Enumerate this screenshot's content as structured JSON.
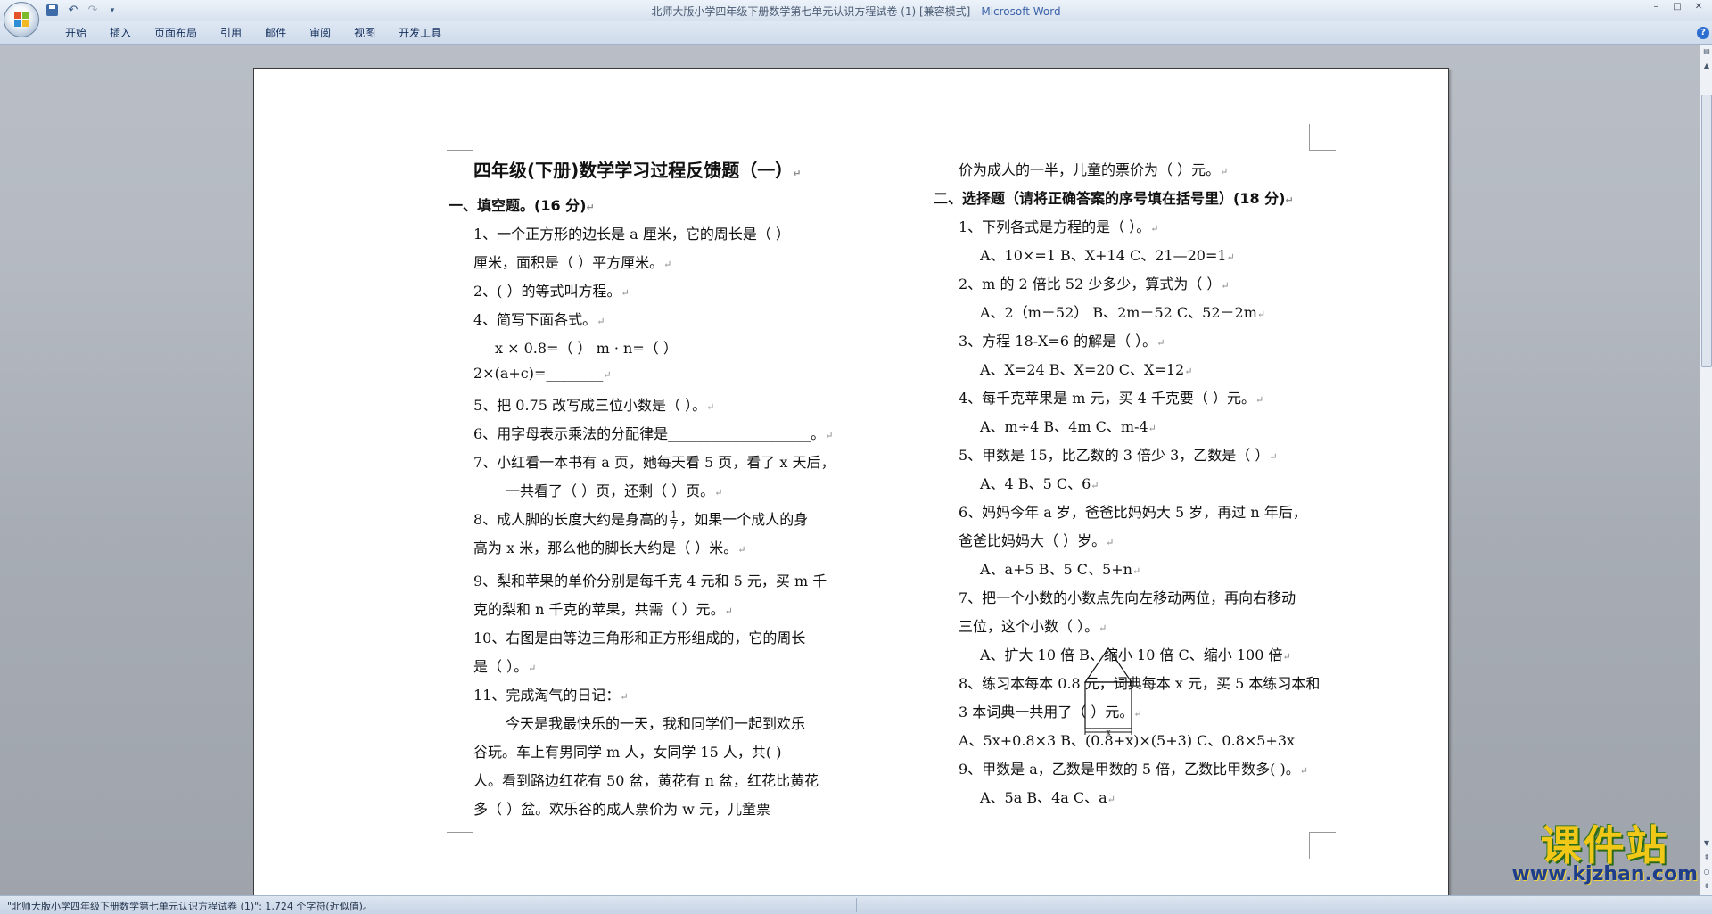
{
  "window": {
    "title": "北师大版小学四年级下册数学第七单元认识方程试卷 (1) [兼容模式]",
    "title_sep": " - ",
    "app": "Microsoft Word",
    "controls": [
      "–",
      "□",
      "✕"
    ]
  },
  "qat": {
    "items": [
      "save",
      "undo",
      "redo",
      "customize"
    ],
    "undo_glyph": "↶",
    "redo_glyph": "↷",
    "more_glyph": "▾"
  },
  "ribbon": {
    "tabs": [
      "开始",
      "插入",
      "页面布局",
      "引用",
      "邮件",
      "审阅",
      "视图",
      "开发工具"
    ],
    "help": "?"
  },
  "document": {
    "title": "四年级(下册)数学学习过程反馈题（一）",
    "left": [
      "一、填空题。(16 分)",
      "1、一个正方形的边长是 a 厘米，它的周长是（        ）",
      "厘米，面积是（        ）平方厘米。",
      "2、(                                        ）的等式叫方程。",
      "4、简写下面各式。",
      "x × 0.8=（          ）           m · n=（            ）",
      "2×(a+c)=________",
      "5、把 0.75 改写成三位小数是（          ）。",
      "6、用字母表示乘法的分配律是____________________。",
      "7、小红看一本书有 a 页，她每天看 5 页，看了 x 天后，",
      "一共看了（        ）页，还剩（          ）页。",
      "8、成人脚的长度大约是身高的",
      "，如果一个成人的身",
      "高为 x 米，那么他的脚长大约是（            ）米。",
      "9、梨和苹果的单价分别是每千克 4 元和 5 元，买 m 千",
      "克的梨和 n 千克的苹果，共需（          ）元。",
      "10、右图是由等边三角形和正方形组成的，它的周长",
      "是（          ）。",
      "11、完成淘气的日记：",
      "今天是我最快乐的一天，我和同学们一起到欢乐",
      "谷玩。车上有男同学 m 人，女同学 15 人，共(          )",
      "人。看到路边红花有 50 盆，黄花有 n 盆，红花比黄花",
      "多（            ）盆。欢乐谷的成人票价为 w 元，儿童票"
    ],
    "fraction": {
      "num": "1",
      "den": "7"
    },
    "figure_label": "x",
    "right": [
      "价为成人的一半，儿童的票价为（          ）元。",
      "二、选择题（请将正确答案的序号填在括号里）(18 分)",
      "1、下列各式是方程的是（          ）。",
      "A、10×=1          B、X+14          C、21—20=1",
      "2、m 的 2 倍比 52 少多少，算式为（          ）",
      "A、2（m－52）       B、2m－52       C、52－2m",
      "3、方程 18-X=6 的解是（          ）。",
      "A、X=24          B、X=20          C、X=12",
      "4、每千克苹果是 m 元，买 4 千克要（          ）元。",
      "A、m÷4          B、4m               C、m-4",
      "5、甲数是 15，比乙数的 3 倍少 3，乙数是（          ）",
      "A、4                    B、5                    C、6",
      "6、妈妈今年 a 岁，爸爸比妈妈大 5 岁，再过 n 年后，",
      "爸爸比妈妈大（        ）岁。",
      "A、a+5                B、5                    C、5+n",
      "7、把一个小数的小数点先向左移动两位，再向右移动",
      "三位，这个小数（        ）。",
      "A、扩大 10 倍     B、缩小 10 倍     C、缩小 100 倍",
      "8、练习本每本 0.8 元，词典每本 x 元，买 5 本练习本和",
      "3 本词典一共用了（        ）元。",
      "A、5x+0.8×3  B、(0.8+x)×(5+3)  C、0.8×5+3x",
      "9、甲数是 a，乙数是甲数的 5 倍，乙数比甲数多(          )。",
      "A、5a                  B、4a                  C、a"
    ],
    "para_mark": "↵"
  },
  "status": {
    "text": "\"北师大版小学四年级下册数学第七单元认识方程试卷 (1)\": 1,724 个字符(近似值)。"
  },
  "watermark": {
    "text": "课件站",
    "url": "www.kjzhan.com"
  },
  "colors": {
    "title_app": "#3b63a8",
    "ribbon_text": "#15315e",
    "watermark_yellow": "#f2c818",
    "watermark_blue": "#1e3e8c"
  }
}
